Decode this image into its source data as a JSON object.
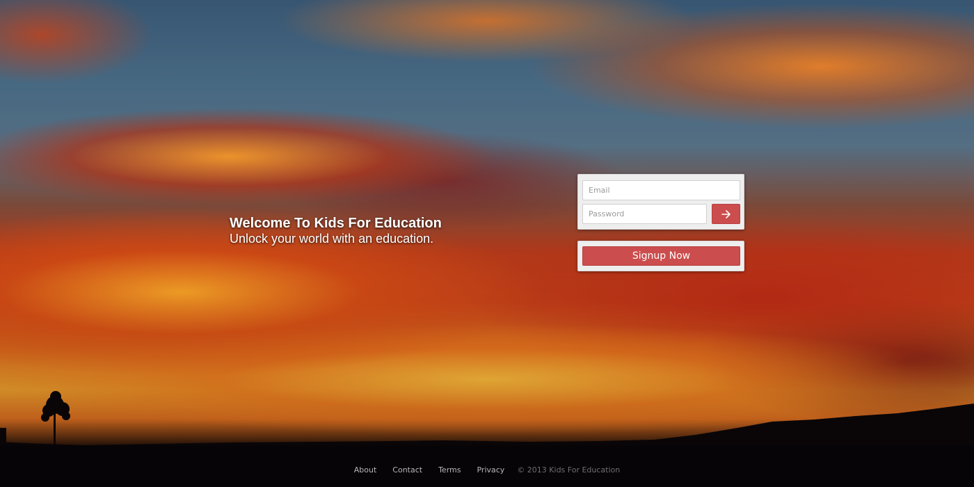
{
  "hero": {
    "title": "Welcome To Kids For Education",
    "subtitle": "Unlock your world with an education."
  },
  "login": {
    "email_placeholder": "Email",
    "password_placeholder": "Password",
    "submit_icon": "arrow-right-icon"
  },
  "signup": {
    "label": "Signup Now"
  },
  "footer": {
    "links": [
      "About",
      "Contact",
      "Terms",
      "Privacy"
    ],
    "copyright": "© 2013 Kids For Education"
  },
  "colors": {
    "accent": "#cc4d4d",
    "card": "#eeeeee",
    "footer_link": "#b8b8b8"
  }
}
